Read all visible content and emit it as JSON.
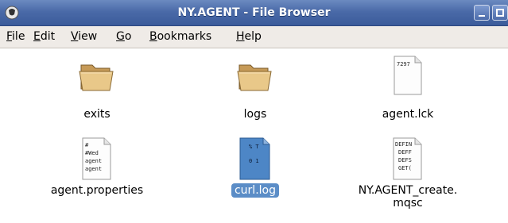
{
  "window": {
    "title": "NY.AGENT - File Browser",
    "icons": {
      "app": "app-icon",
      "minimize": "minimize-icon",
      "maximize": "maximize-icon",
      "close": "close-icon"
    }
  },
  "menu": {
    "items": [
      {
        "mnemonic": "F",
        "rest": "ile"
      },
      {
        "mnemonic": "E",
        "rest": "dit"
      },
      {
        "mnemonic": "V",
        "rest": "iew"
      },
      {
        "mnemonic": "G",
        "rest": "o"
      },
      {
        "mnemonic": "B",
        "rest": "ookmarks"
      },
      {
        "mnemonic": "H",
        "rest": "elp"
      }
    ]
  },
  "files": [
    {
      "name": "exits",
      "icon": "folder-icon",
      "selected": false
    },
    {
      "name": "logs",
      "icon": "folder-icon",
      "selected": false
    },
    {
      "name": "agent.lck",
      "icon": "text-file-icon",
      "preview": [
        "7297"
      ],
      "selected": false
    },
    {
      "name": "agent.properties",
      "icon": "text-file-icon",
      "preview": [
        "#",
        "#Wed",
        "agent",
        "agent"
      ],
      "selected": false
    },
    {
      "name": "curl.log",
      "icon": "log-file-icon",
      "preview": [
        "% T",
        "0 1"
      ],
      "selected": true
    },
    {
      "name_line1": "NY.AGENT_create.",
      "name_line2": "mqsc",
      "icon": "text-file-icon",
      "preview": [
        "DEFIN",
        "DEFF",
        "DEFS",
        "GET("
      ],
      "selected": false
    }
  ],
  "colors": {
    "selection": "#5b8dc7",
    "titlebar": "#4a6aa8",
    "menubar": "#efebe7"
  }
}
